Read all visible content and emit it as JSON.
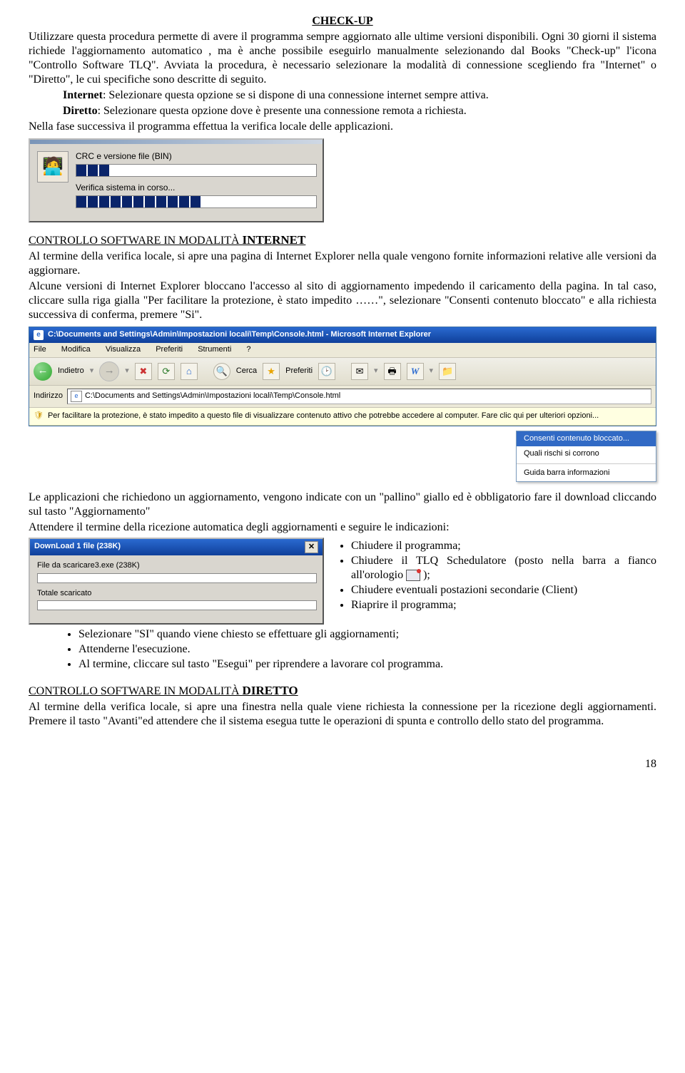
{
  "title": "CHECK-UP",
  "p1": "Utilizzare questa procedura permette di avere il programma sempre aggiornato alle ultime versioni disponibili. Ogni 30 giorni il sistema richiede l'aggiornamento automatico , ma è anche possibile eseguirlo manualmente selezionando dal Books \"Check-up\" l'icona \"Controllo Software TLQ\". Avviata la procedura, è necessario selezionare la modalità di connessione scegliendo fra \"Internet\" o \"Diretto\", le cui specifiche sono descritte di seguito.",
  "opt_internet_label": "Internet",
  "opt_internet_text": ": Selezionare questa opzione se si dispone di una connessione internet sempre attiva.",
  "opt_diretto_label": "Diretto",
  "opt_diretto_text": ": Selezionare questa opzione dove è presente una connessione remota a richiesta.",
  "p2": "Nella fase successiva il programma effettua la verifica locale delle applicazioni.",
  "dlg1": {
    "label1": "CRC e versione file (BIN)",
    "label2": "Verifica sistema in corso..."
  },
  "sec1_prefix": "C",
  "sec1_rest": "ONTROLLO SOFTWARE IN MODALITÀ ",
  "sec1_mode": "INTERNET",
  "p3": "Al termine della verifica locale, si apre una pagina di Internet Explorer nella quale vengono fornite informazioni relative alle versioni da aggiornare.",
  "p4": "Alcune versioni di Internet Explorer bloccano l'accesso al sito di aggiornamento impedendo il caricamento della pagina. In tal caso, cliccare sulla riga gialla \"Per facilitare la protezione, è stato impedito ……\", selezionare \"Consenti contenuto bloccato\" e alla richiesta successiva di conferma, premere \"Si\".",
  "ie": {
    "title": "C:\\Documents and Settings\\Admin\\Impostazioni locali\\Temp\\Console.html - Microsoft Internet Explorer",
    "menu": [
      "File",
      "Modifica",
      "Visualizza",
      "Preferiti",
      "Strumenti",
      "?"
    ],
    "back": "Indietro",
    "search": "Cerca",
    "favorites": "Preferiti",
    "addr_label": "Indirizzo",
    "addr_value": "C:\\Documents and Settings\\Admin\\Impostazioni locali\\Temp\\Console.html",
    "infobar": "Per facilitare la protezione, è stato impedito a questo file di visualizzare contenuto attivo che potrebbe accedere al computer. Fare clic qui per ulteriori opzioni...",
    "cmenu": [
      "Consenti contenuto bloccato...",
      "Quali rischi si corrono",
      "Guida barra informazioni"
    ]
  },
  "p5": "Le applicazioni che richiedono un aggiornamento, vengono indicate con un \"pallino\" giallo ed è obbligatorio fare il download cliccando sul tasto \"Aggiornamento\"",
  "p6": "Attendere il termine della ricezione automatica degli aggiornamenti e seguire le indicazioni:",
  "dl": {
    "title": "DownLoad 1 file (238K)",
    "line1": "File da scaricare3.exe (238K)",
    "line2": "Totale scaricato"
  },
  "rbul": [
    "Chiudere il programma;",
    [
      "Chiudere il TLQ Schedulatore (posto nella barra a fianco all'orologio ",
      " );"
    ],
    "Chiudere eventuali postazioni secondarie (Client)",
    "Riaprire il programma;"
  ],
  "bul2": [
    "Selezionare \"SI\" quando viene chiesto se effettuare gli aggiornamenti;",
    "Attenderne l'esecuzione.",
    "Al termine, cliccare sul tasto \"Esegui\" per riprendere a lavorare col programma."
  ],
  "sec2_label": "CONTROLLO SOFTWARE IN MODALITÀ ",
  "sec2_mode": "DIRETTO",
  "p7": "Al termine della verifica locale, si  apre una finestra nella quale viene richiesta la connessione per la ricezione degli aggiornamenti. Premere il tasto \"Avanti\"ed attendere che il sistema esegua tutte le operazioni di spunta e controllo dello stato del programma.",
  "page_number": "18"
}
